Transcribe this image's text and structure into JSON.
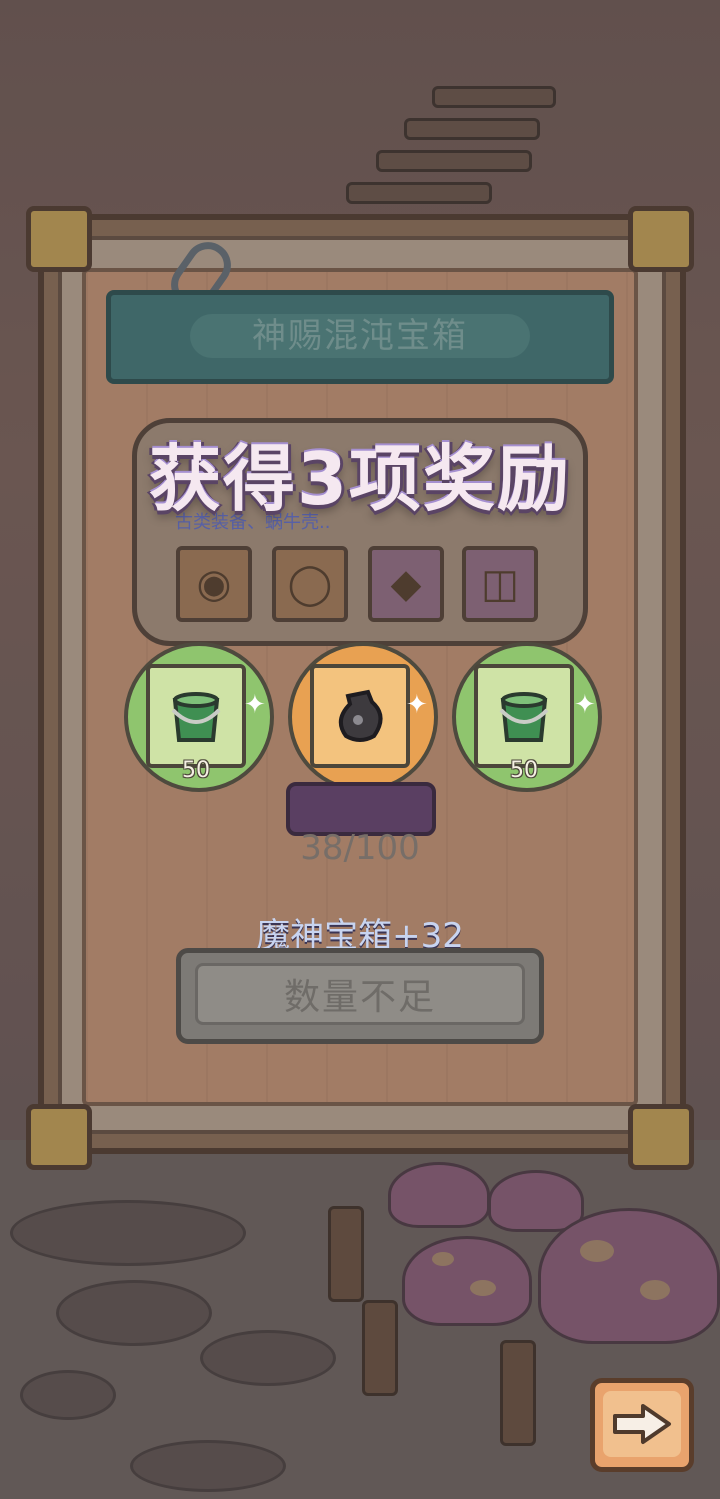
{
  "panel": {
    "title": "神赐混沌宝箱",
    "pool_description": "古类装备、蜗牛壳..",
    "pool_items": [
      {
        "icon": "eye-gear-icon"
      },
      {
        "icon": "ring-icon"
      },
      {
        "icon": "amulet-icon"
      },
      {
        "icon": "bucket-icon"
      }
    ],
    "progress_text": "38/100",
    "chest_label": "魔神宝箱+32",
    "action_button_label": "数量不足"
  },
  "popup": {
    "headline": "获得3项奖励",
    "rewards": [
      {
        "icon": "green-bucket-icon",
        "count": "50",
        "rarity": "green"
      },
      {
        "icon": "dark-pouch-icon",
        "count": "",
        "rarity": "orange"
      },
      {
        "icon": "green-bucket-icon",
        "count": "50",
        "rarity": "green"
      }
    ]
  },
  "navigation": {
    "next_icon": "right-arrow-icon"
  },
  "colors": {
    "green_rarity": "#8fc56e",
    "orange_rarity": "#e8a152",
    "headline_outline": "#5a4465"
  }
}
